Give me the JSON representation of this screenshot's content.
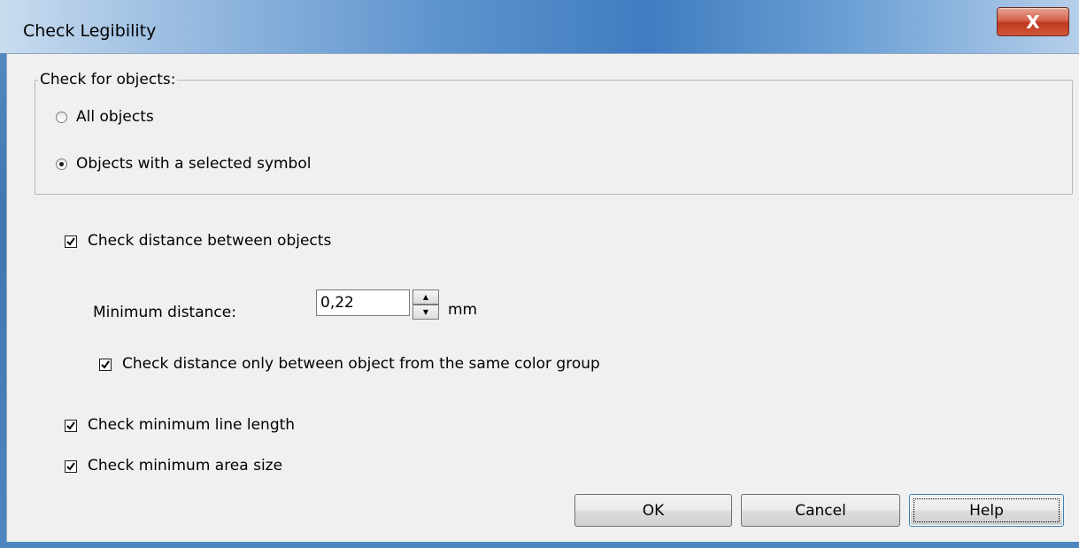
{
  "window": {
    "title": "Check Legibility",
    "close_label": "X"
  },
  "group": {
    "legend": "Check for objects:",
    "options": [
      {
        "label": "All objects",
        "selected": false
      },
      {
        "label": "Objects with a selected symbol",
        "selected": true
      }
    ]
  },
  "checks": {
    "distance_between_objects": {
      "label": "Check distance between objects",
      "checked": true
    },
    "min_distance_label": "Minimum distance:",
    "min_distance_value": "0,22",
    "min_distance_unit": "mm",
    "same_color_group": {
      "label": "Check distance only between object from the same color group",
      "checked": true
    },
    "min_line_length": {
      "label": "Check minimum line length",
      "checked": true
    },
    "min_area_size": {
      "label": "Check minimum area size",
      "checked": true
    }
  },
  "buttons": {
    "ok": "OK",
    "cancel": "Cancel",
    "help": "Help"
  },
  "spinner": {
    "up": "▲",
    "down": "▼"
  }
}
